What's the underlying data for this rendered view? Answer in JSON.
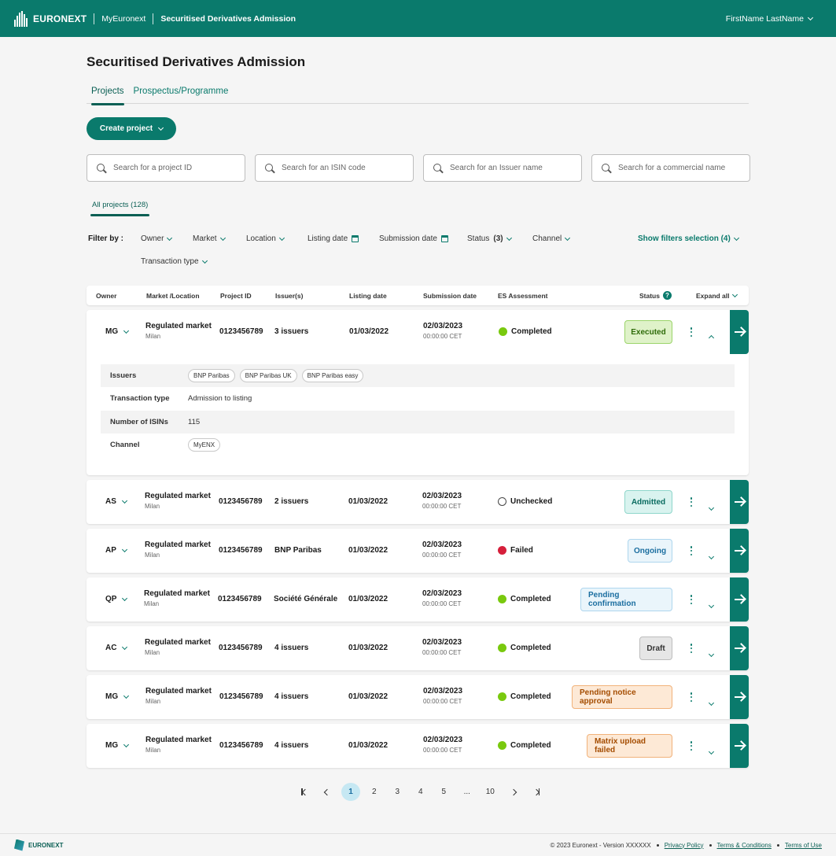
{
  "header": {
    "brand": "EURONEXT",
    "app_link": "MyEuronext",
    "current_page": "Securitised Derivatives Admission",
    "user_name": "FirstName LastName"
  },
  "page_title": "Securitised Derivatives Admission",
  "tabs": [
    {
      "label": "Projects",
      "active": true
    },
    {
      "label": "Prospectus/Programme",
      "active": false
    }
  ],
  "create_button": "Create project",
  "searches": [
    {
      "placeholder": "Search for a project ID"
    },
    {
      "placeholder": "Search for an ISIN code"
    },
    {
      "placeholder": "Search for an Issuer name"
    },
    {
      "placeholder": "Search for a commercial name"
    }
  ],
  "all_projects_label": "All projects (128)",
  "filters": {
    "label": "Filter by :",
    "owner": "Owner",
    "market": "Market",
    "location": "Location",
    "listing_date": "Listing date",
    "submission_date": "Submission date",
    "status": "Status",
    "status_count": "(3)",
    "channel": "Channel",
    "transaction_type": "Transaction type",
    "show_selection": "Show filters selection (4)"
  },
  "columns": {
    "owner": "Owner",
    "market": "Market /Location",
    "project_id": "Project ID",
    "issuers": "Issuer(s)",
    "listing_date": "Listing date",
    "submission_date": "Submission date",
    "es_assessment": "ES Assessment",
    "status": "Status",
    "expand_all": "Expand all"
  },
  "rows": [
    {
      "owner": "MG",
      "market": "Regulated market",
      "location": "Milan",
      "project_id": "0123456789",
      "issuers": "3 issuers",
      "listing_date": "01/03/2022",
      "submission_date": "02/03/2023",
      "submission_time": "00:00:00 CET",
      "es": "Completed",
      "status": "Executed"
    },
    {
      "owner": "AS",
      "market": "Regulated market",
      "location": "Milan",
      "project_id": "0123456789",
      "issuers": "2 issuers",
      "listing_date": "01/03/2022",
      "submission_date": "02/03/2023",
      "submission_time": "00:00:00 CET",
      "es": "Unchecked",
      "status": "Admitted"
    },
    {
      "owner": "AP",
      "market": "Regulated market",
      "location": "Milan",
      "project_id": "0123456789",
      "issuers": "BNP Paribas",
      "listing_date": "01/03/2022",
      "submission_date": "02/03/2023",
      "submission_time": "00:00:00 CET",
      "es": "Failed",
      "status": "Ongoing"
    },
    {
      "owner": "QP",
      "market": "Regulated market",
      "location": "Milan",
      "project_id": "0123456789",
      "issuers": "Société Générale",
      "listing_date": "01/03/2022",
      "submission_date": "02/03/2023",
      "submission_time": "00:00:00 CET",
      "es": "Completed",
      "status": "Pending confirmation"
    },
    {
      "owner": "AC",
      "market": "Regulated market",
      "location": "Milan",
      "project_id": "0123456789",
      "issuers": "4 issuers",
      "listing_date": "01/03/2022",
      "submission_date": "02/03/2023",
      "submission_time": "00:00:00 CET",
      "es": "Completed",
      "status": "Draft"
    },
    {
      "owner": "MG",
      "market": "Regulated market",
      "location": "Milan",
      "project_id": "0123456789",
      "issuers": "4 issuers",
      "listing_date": "01/03/2022",
      "submission_date": "02/03/2023",
      "submission_time": "00:00:00 CET",
      "es": "Completed",
      "status": "Pending notice approval"
    },
    {
      "owner": "MG",
      "market": "Regulated market",
      "location": "Milan",
      "project_id": "0123456789",
      "issuers": "4 issuers",
      "listing_date": "01/03/2022",
      "submission_date": "02/03/2023",
      "submission_time": "00:00:00 CET",
      "es": "Completed",
      "status": "Matrix upload failed"
    }
  ],
  "details": {
    "issuers_label": "Issuers",
    "issuers": [
      "BNP Paribas",
      "BNP Paribas UK",
      "BNP Paribas easy"
    ],
    "transaction_label": "Transaction type",
    "transaction_value": "Admission to listing",
    "isins_label": "Number of ISINs",
    "isins_value": "115",
    "channel_label": "Channel",
    "channel_value": "MyENX"
  },
  "pagination": {
    "pages": [
      "1",
      "2",
      "3",
      "4",
      "5",
      "...",
      "10"
    ],
    "current": "1"
  },
  "footer": {
    "brand": "EURONEXT",
    "copyright": "© 2023 Euronext - Version XXXXXX",
    "privacy": "Privacy Policy",
    "terms_conditions": "Terms & Conditions",
    "terms_use": "Terms of Use"
  },
  "colors": {
    "brand": "#0a7a6c",
    "completed": "#79c90e",
    "failed": "#d61f3b"
  }
}
